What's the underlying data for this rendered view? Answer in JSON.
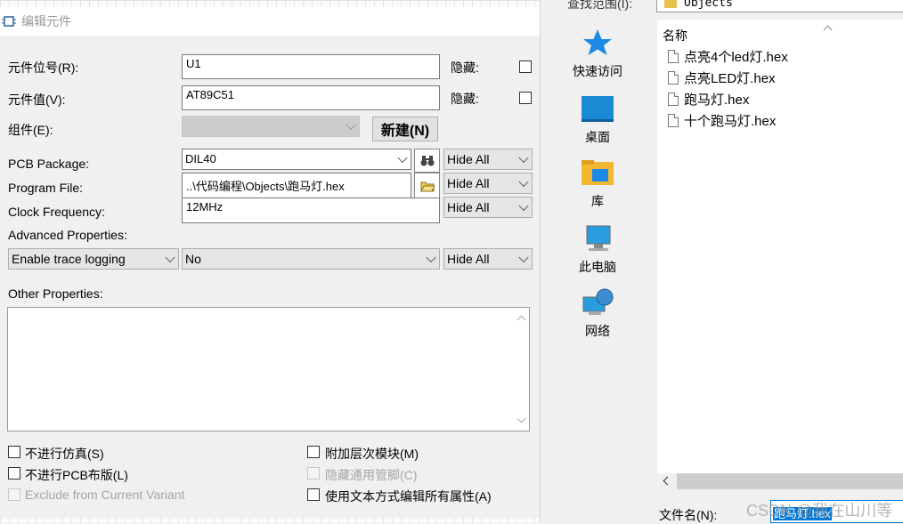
{
  "edit_dialog": {
    "title": "编辑元件",
    "part_reference": {
      "label": "元件位号(R):",
      "value": "U1",
      "hidden_label": "隐藏:"
    },
    "part_value": {
      "label": "元件值(V):",
      "value": "AT89C51",
      "hidden_label": "隐藏:"
    },
    "element": {
      "label": "组件(E):",
      "value": "",
      "new_button": "新建(N)"
    },
    "pcb_package": {
      "label": "PCB Package:",
      "value": "DIL40",
      "visibility": "Hide All"
    },
    "program_file": {
      "label": "Program File:",
      "value": "..\\代码编程\\Objects\\跑马灯.hex",
      "visibility": "Hide All"
    },
    "clock_frequency": {
      "label": "Clock Frequency:",
      "value": "12MHz",
      "visibility": "Hide All"
    },
    "advanced": {
      "label": "Advanced Properties:",
      "property": "Enable trace logging",
      "value": "No",
      "visibility": "Hide All"
    },
    "other_properties_label": "Other Properties:",
    "other_properties_value": "",
    "checkboxes": {
      "no_simulate": "不进行仿真(S)",
      "no_pcb": "不进行PCB布版(L)",
      "exclude_variant": "Exclude from Current Variant",
      "attach_hierarchy": "附加层次模块(M)",
      "hide_pins": "隐藏通用管脚(C)",
      "edit_as_text": "使用文本方式编辑所有属性(A)"
    }
  },
  "file_dialog": {
    "lookin_label": "查找范围(I):",
    "lookin_value": "Objects",
    "places": [
      {
        "label": "快速访问",
        "icon": "star-icon"
      },
      {
        "label": "桌面",
        "icon": "desktop-icon"
      },
      {
        "label": "库",
        "icon": "library-icon"
      },
      {
        "label": "此电脑",
        "icon": "computer-icon"
      },
      {
        "label": "网络",
        "icon": "network-icon"
      }
    ],
    "column_name": "名称",
    "files": [
      "点亮4个led灯.hex",
      "点亮LED灯.hex",
      "跑马灯.hex",
      "十个跑马灯.hex"
    ],
    "filename_label": "文件名(N):",
    "filename_value": "跑马灯.hex"
  },
  "watermark": "CSDN @我在山川等",
  "colors": {
    "selection": "#0078d7",
    "folder": "#e8c050",
    "star": "#1e88e5"
  }
}
